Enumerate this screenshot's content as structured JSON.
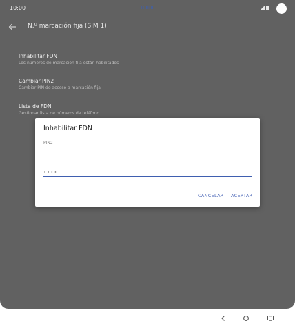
{
  "status_bar": {
    "time": "10:00",
    "carrier": "IIIIIIII",
    "icons": [
      "signal-icon",
      "battery-icon"
    ]
  },
  "app_bar": {
    "title": "N.º marcación fija (SIM 1)",
    "back_icon": "arrow-back-icon"
  },
  "settings": [
    {
      "title": "Inhabilitar FDN",
      "subtitle": "Los números de marcación fija están habilitados"
    },
    {
      "title": "Cambiar PIN2",
      "subtitle": "Cambiar PIN de acceso a marcación fija"
    },
    {
      "title": "Lista de FDN",
      "subtitle": "Gestionar lista de números de teléfono"
    }
  ],
  "dialog": {
    "title": "Inhabilitar FDN",
    "field_label": "PIN2",
    "field_value": "••••",
    "cancel_label": "CANCELAR",
    "ok_label": "ACEPTAR"
  },
  "nav_bar": {
    "icons": [
      "back-icon",
      "home-icon",
      "recents-icon"
    ]
  },
  "colors": {
    "scrim": "#616161",
    "accent": "#4562b5",
    "dialog_bg": "#ffffff"
  }
}
